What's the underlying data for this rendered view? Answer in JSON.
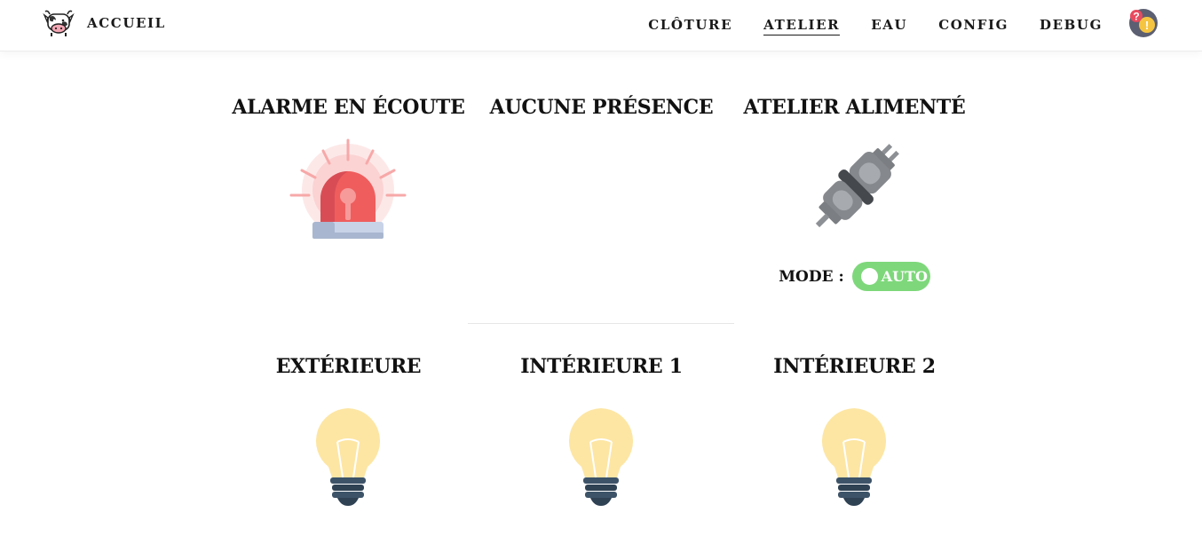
{
  "nav": {
    "home_label": "ACCUEIL",
    "links": [
      "CLÔTURE",
      "ATELIER",
      "EAU",
      "CONFIG",
      "DEBUG"
    ],
    "active": "ATELIER"
  },
  "status": {
    "alarm_title": "ALARME EN ÉCOUTE",
    "presence_title": "AUCUNE PRÉSENCE",
    "power_title": "ATELIER ALIMENTÉ",
    "mode_label": "MODE :",
    "mode_value": "AUTO"
  },
  "lights": [
    {
      "label": "EXTÉRIEURE"
    },
    {
      "label": "INTÉRIEURE 1"
    },
    {
      "label": "INTÉRIEURE 2"
    }
  ],
  "icons": {
    "brand": "cow-icon",
    "avatar": "help-warning-icon",
    "alarm": "siren-icon",
    "power": "plug-icon",
    "light": "light-bulb-icon"
  },
  "colors": {
    "toggle_on": "#7ed87b",
    "siren_red": "#ef5d5d",
    "bulb_yellow": "#fde6a4",
    "bulb_base": "#3d5368"
  }
}
